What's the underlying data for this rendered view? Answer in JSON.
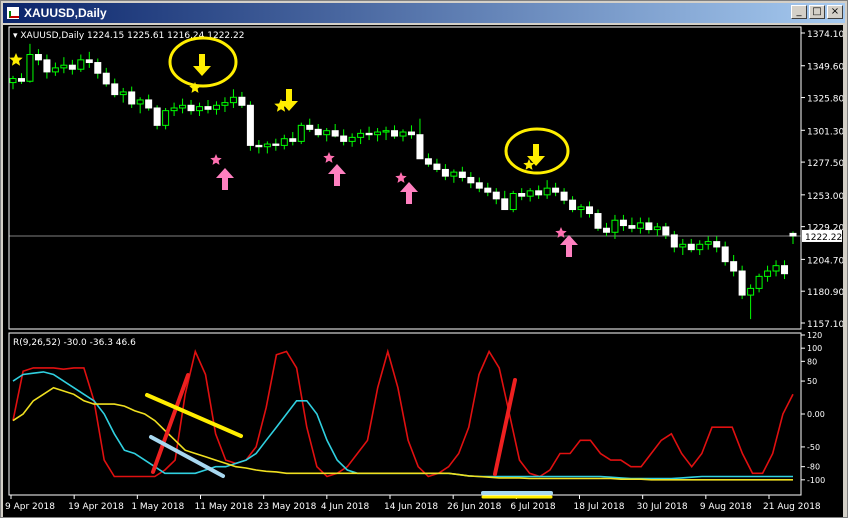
{
  "window": {
    "title": "XAUUSD,Daily",
    "minimize_glyph": "_",
    "restore_glyph": "□",
    "close_glyph": "×"
  },
  "colors": {
    "background": "#000000",
    "foreground": "#ffffff",
    "bull_candle": "#00ff00",
    "bear_candle": "#ffffff",
    "indicator_red": "#e01010",
    "indicator_cyan": "#30d0e0",
    "indicator_yellow": "#f0e020",
    "star_yellow": "#ffee00",
    "star_pink": "#ff70b0",
    "arrow_pink": "#ff80c0",
    "arrow_yellow": "#ffee00",
    "trendline_red": "#ee2020",
    "trendline_blue": "#a8d8f0",
    "trendline_yellow": "#ffee00"
  },
  "main_panel": {
    "info_label": "XAUUSD,Daily  1224.15 1225.61 1216.24 1222.22",
    "price_ticks": [
      "1374.10",
      "1349.60",
      "1325.80",
      "1301.30",
      "1277.50",
      "1253.00",
      "1229.20",
      "1204.70",
      "1180.90",
      "1157.10"
    ],
    "current_price_label": "1222.22",
    "icon_names": [
      "yellow-star-icon",
      "yellow-down-arrow-icon",
      "pink-star-icon",
      "pink-up-arrow-icon",
      "yellow-circle-highlight"
    ]
  },
  "indicator_panel": {
    "label": "R(9,26,52) -30.0 -36.3 46.6",
    "ticks": [
      "120",
      "100",
      "80",
      "50",
      "0.00",
      "-50",
      "-80",
      "-100"
    ]
  },
  "x_axis": {
    "labels": [
      "9 Apr 2018",
      "19 Apr 2018",
      "1 May 2018",
      "11 May 2018",
      "23 May 2018",
      "4 Jun 2018",
      "14 Jun 2018",
      "26 Jun 2018",
      "6 Jul 2018",
      "18 Jul 2018",
      "30 Jul 2018",
      "9 Aug 2018",
      "21 Aug 2018"
    ]
  },
  "chart_data": {
    "type": "candlestick",
    "symbol": "XAUUSD",
    "timeframe": "Daily",
    "ylim": [
      1157.1,
      1374.1
    ],
    "last_bar": {
      "open": 1224.15,
      "high": 1225.61,
      "low": 1216.24,
      "close": 1222.22
    },
    "candles": [
      [
        1337,
        1342,
        1332,
        1340
      ],
      [
        1340,
        1344,
        1336,
        1338
      ],
      [
        1338,
        1366,
        1337,
        1358
      ],
      [
        1358,
        1362,
        1350,
        1354
      ],
      [
        1354,
        1358,
        1340,
        1345
      ],
      [
        1345,
        1352,
        1342,
        1348
      ],
      [
        1348,
        1356,
        1344,
        1350
      ],
      [
        1350,
        1354,
        1343,
        1347
      ],
      [
        1347,
        1358,
        1345,
        1354
      ],
      [
        1354,
        1360,
        1348,
        1352
      ],
      [
        1352,
        1355,
        1340,
        1344
      ],
      [
        1344,
        1348,
        1334,
        1336
      ],
      [
        1336,
        1340,
        1326,
        1328
      ],
      [
        1328,
        1333,
        1322,
        1330
      ],
      [
        1330,
        1334,
        1318,
        1321
      ],
      [
        1321,
        1326,
        1314,
        1324
      ],
      [
        1324,
        1328,
        1316,
        1318
      ],
      [
        1318,
        1320,
        1302,
        1305
      ],
      [
        1305,
        1318,
        1302,
        1316
      ],
      [
        1316,
        1322,
        1312,
        1318
      ],
      [
        1318,
        1325,
        1314,
        1320
      ],
      [
        1320,
        1324,
        1313,
        1316
      ],
      [
        1316,
        1322,
        1312,
        1319
      ],
      [
        1319,
        1324,
        1314,
        1317
      ],
      [
        1317,
        1323,
        1313,
        1320
      ],
      [
        1320,
        1326,
        1315,
        1322
      ],
      [
        1322,
        1332,
        1318,
        1326
      ],
      [
        1326,
        1330,
        1318,
        1320
      ],
      [
        1320,
        1323,
        1286,
        1290
      ],
      [
        1290,
        1294,
        1284,
        1289
      ],
      [
        1289,
        1293,
        1284,
        1291
      ],
      [
        1291,
        1295,
        1286,
        1290
      ],
      [
        1290,
        1298,
        1287,
        1295
      ],
      [
        1295,
        1300,
        1290,
        1293
      ],
      [
        1293,
        1307,
        1291,
        1305
      ],
      [
        1305,
        1310,
        1300,
        1302
      ],
      [
        1302,
        1306,
        1296,
        1298
      ],
      [
        1298,
        1303,
        1293,
        1301
      ],
      [
        1301,
        1306,
        1296,
        1297
      ],
      [
        1297,
        1302,
        1290,
        1293
      ],
      [
        1293,
        1299,
        1289,
        1296
      ],
      [
        1296,
        1302,
        1291,
        1299
      ],
      [
        1299,
        1304,
        1294,
        1298
      ],
      [
        1298,
        1303,
        1293,
        1300
      ],
      [
        1300,
        1304,
        1294,
        1301
      ],
      [
        1301,
        1305,
        1295,
        1297
      ],
      [
        1297,
        1302,
        1293,
        1300
      ],
      [
        1300,
        1305,
        1295,
        1298
      ],
      [
        1298,
        1310,
        1290,
        1280
      ],
      [
        1280,
        1284,
        1274,
        1276
      ],
      [
        1276,
        1280,
        1270,
        1272
      ],
      [
        1272,
        1276,
        1264,
        1267
      ],
      [
        1267,
        1272,
        1262,
        1270
      ],
      [
        1270,
        1274,
        1263,
        1266
      ],
      [
        1266,
        1270,
        1258,
        1262
      ],
      [
        1262,
        1266,
        1255,
        1258
      ],
      [
        1258,
        1262,
        1252,
        1255
      ],
      [
        1255,
        1258,
        1246,
        1250
      ],
      [
        1250,
        1256,
        1244,
        1242
      ],
      [
        1242,
        1256,
        1240,
        1254
      ],
      [
        1254,
        1258,
        1249,
        1252
      ],
      [
        1252,
        1258,
        1248,
        1256
      ],
      [
        1256,
        1260,
        1250,
        1253
      ],
      [
        1253,
        1264,
        1250,
        1258
      ],
      [
        1258,
        1262,
        1252,
        1255
      ],
      [
        1255,
        1258,
        1246,
        1249
      ],
      [
        1249,
        1252,
        1240,
        1242
      ],
      [
        1242,
        1246,
        1236,
        1244
      ],
      [
        1244,
        1248,
        1236,
        1239
      ],
      [
        1239,
        1242,
        1226,
        1228
      ],
      [
        1228,
        1232,
        1222,
        1225
      ],
      [
        1225,
        1238,
        1220,
        1234
      ],
      [
        1234,
        1238,
        1226,
        1230
      ],
      [
        1230,
        1236,
        1225,
        1228
      ],
      [
        1228,
        1236,
        1224,
        1232
      ],
      [
        1232,
        1236,
        1224,
        1227
      ],
      [
        1227,
        1232,
        1222,
        1229
      ],
      [
        1229,
        1232,
        1220,
        1223
      ],
      [
        1223,
        1226,
        1210,
        1214
      ],
      [
        1214,
        1220,
        1208,
        1216
      ],
      [
        1216,
        1220,
        1210,
        1212
      ],
      [
        1212,
        1219,
        1208,
        1216
      ],
      [
        1216,
        1222,
        1212,
        1218
      ],
      [
        1218,
        1222,
        1210,
        1214
      ],
      [
        1214,
        1218,
        1200,
        1203
      ],
      [
        1203,
        1208,
        1192,
        1196
      ],
      [
        1196,
        1200,
        1175,
        1178
      ],
      [
        1178,
        1186,
        1160,
        1183
      ],
      [
        1183,
        1194,
        1180,
        1192
      ],
      [
        1192,
        1200,
        1188,
        1196
      ],
      [
        1196,
        1204,
        1192,
        1200
      ],
      [
        1200,
        1204,
        1190,
        1194
      ],
      [
        1224.15,
        1225.61,
        1216.24,
        1222.22
      ]
    ],
    "indicator": {
      "name": "R(9,26,52)",
      "ylim": [
        -120,
        120
      ],
      "series": [
        {
          "values": [
            -10,
            65,
            70,
            70,
            70,
            68,
            70,
            70,
            20,
            -70,
            -95,
            -95,
            -95,
            -95,
            -95,
            -85,
            -70,
            30,
            95,
            60,
            -30,
            -70,
            -75,
            -70,
            -50,
            10,
            90,
            95,
            70,
            -20,
            -80,
            -95,
            -90,
            -80,
            -60,
            -40,
            40,
            95,
            40,
            -40,
            -80,
            -95,
            -90,
            -80,
            -60,
            -20,
            60,
            95,
            70,
            0,
            -70,
            -90,
            -95,
            -85,
            -60,
            -60,
            -40,
            -40,
            -60,
            -70,
            -70,
            -80,
            -80,
            -60,
            -40,
            -30,
            -60,
            -80,
            -60,
            -20,
            -20,
            -20,
            -60,
            -90,
            -90,
            -60,
            0,
            30
          ]
        },
        {
          "values": [
            50,
            60,
            62,
            64,
            60,
            50,
            40,
            30,
            20,
            0,
            -30,
            -55,
            -60,
            -70,
            -80,
            -90,
            -90,
            -90,
            -90,
            -85,
            -80,
            -80,
            -75,
            -70,
            -60,
            -40,
            -20,
            0,
            20,
            20,
            0,
            -40,
            -70,
            -85,
            -90,
            -90,
            -90,
            -90,
            -90,
            -90,
            -90,
            -90,
            -90,
            -90,
            -92,
            -94,
            -95,
            -95,
            -95,
            -95,
            -95,
            -95,
            -95,
            -95,
            -95,
            -95,
            -95,
            -95,
            -95,
            -96,
            -97,
            -98,
            -98,
            -98,
            -98,
            -98,
            -97,
            -96,
            -95,
            -95,
            -95,
            -95,
            -95,
            -95,
            -95,
            -95,
            -95,
            -95
          ]
        },
        {
          "values": [
            -10,
            0,
            20,
            30,
            40,
            35,
            30,
            20,
            15,
            15,
            15,
            12,
            5,
            0,
            -10,
            -25,
            -40,
            -55,
            -60,
            -65,
            -70,
            -75,
            -80,
            -82,
            -85,
            -87,
            -88,
            -90,
            -90,
            -90,
            -90,
            -90,
            -90,
            -90,
            -90,
            -90,
            -90,
            -90,
            -90,
            -90,
            -90,
            -90,
            -90,
            -90,
            -92,
            -94,
            -95,
            -96,
            -97,
            -97,
            -97,
            -98,
            -98,
            -98,
            -98,
            -98,
            -98,
            -98,
            -98,
            -98,
            -99,
            -99,
            -99,
            -100,
            -100,
            -100,
            -100,
            -100,
            -100,
            -100,
            -100,
            -100,
            -100,
            -100,
            -100,
            -100,
            -100,
            -100
          ]
        }
      ]
    }
  }
}
